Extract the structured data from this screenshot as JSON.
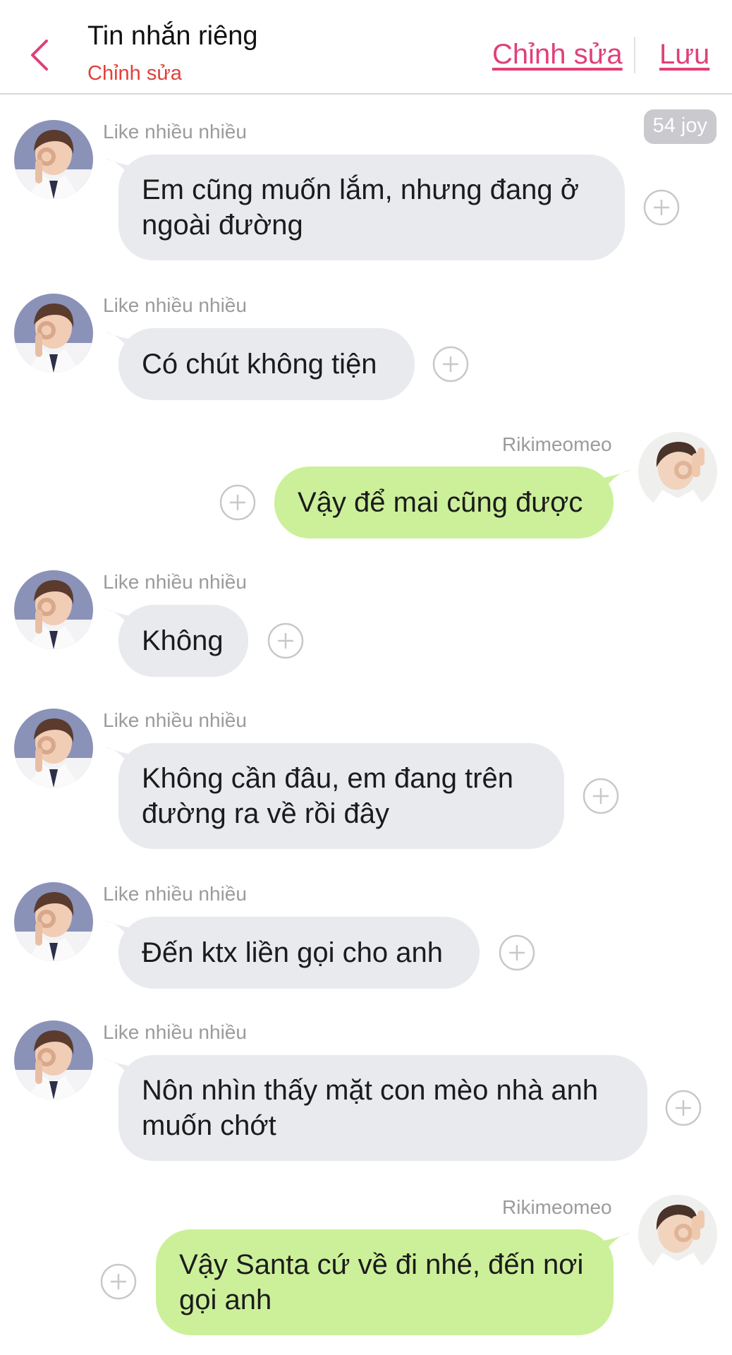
{
  "header": {
    "title": "Tin nhắn riêng",
    "subtitle": "Chỉnh sửa",
    "edit_label": "Chỉnh sửa",
    "save_label": "Lưu"
  },
  "joy_badge": "54 joy",
  "colors": {
    "accent": "#e0407a",
    "subtitle": "#e0413b",
    "incoming_bubble": "#e8eaee",
    "outgoing_bubble": "#ccf09a"
  },
  "messages": [
    {
      "sender": "Like nhiều nhiều",
      "text": "Em cũng muốn lắm, nhưng đang ở ngoài đường",
      "direction": "incoming"
    },
    {
      "sender": "Like nhiều nhiều",
      "text": "Có chút không tiện",
      "direction": "incoming"
    },
    {
      "sender": "Rikimeomeo",
      "text": "Vậy để mai cũng được",
      "direction": "outgoing"
    },
    {
      "sender": "Like nhiều nhiều",
      "text": "Không",
      "direction": "incoming"
    },
    {
      "sender": "Like nhiều nhiều",
      "text": "Không cần đâu, em đang trên đường ra về rồi đây",
      "direction": "incoming"
    },
    {
      "sender": "Like nhiều nhiều",
      "text": "Đến ktx liền gọi cho anh",
      "direction": "incoming"
    },
    {
      "sender": "Like nhiều nhiều",
      "text": "Nôn nhìn thấy mặt con mèo nhà anh muốn chớt",
      "direction": "incoming"
    },
    {
      "sender": "Rikimeomeo",
      "text": "Vậy Santa cứ về đi nhé, đến nơi gọi anh",
      "direction": "outgoing"
    }
  ]
}
